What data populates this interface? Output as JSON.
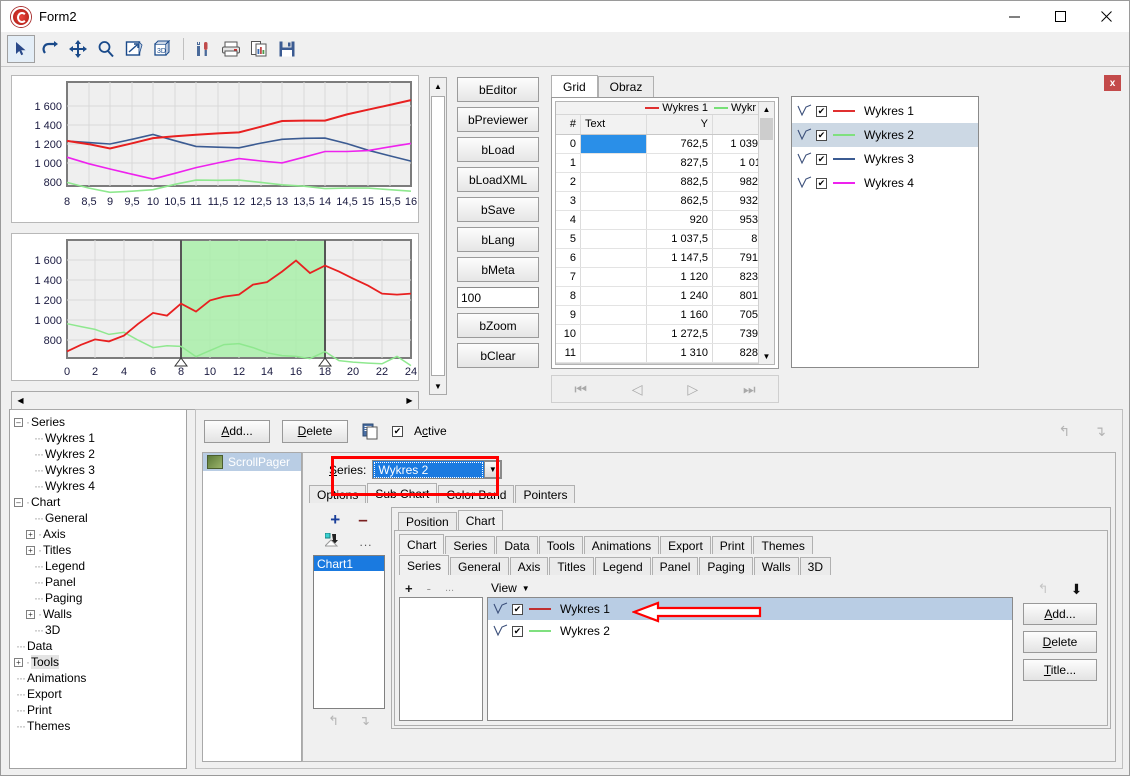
{
  "window": {
    "title": "Form2",
    "minimize": "–",
    "maximize": "□",
    "close": "✕"
  },
  "toolbar": {
    "items": [
      {
        "name": "pointer-icon",
        "label": "Pointer"
      },
      {
        "name": "undo-icon",
        "label": "Undo"
      },
      {
        "name": "move-icon",
        "label": "Move"
      },
      {
        "name": "zoom-icon",
        "label": "Zoom"
      },
      {
        "name": "export-chart-icon",
        "label": "Export"
      },
      {
        "name": "three-d-icon",
        "label": "3D"
      },
      {
        "name": "tools-icon",
        "label": "Tools"
      },
      {
        "name": "print-icon",
        "label": "Print"
      },
      {
        "name": "copy-chart-icon",
        "label": "Copy"
      },
      {
        "name": "save-icon",
        "label": "Save"
      }
    ]
  },
  "buttons_column": {
    "items": [
      "bEditor",
      "bPreviewer",
      "bLoad",
      "bLoadXML",
      "bSave",
      "bLang",
      "bMeta"
    ],
    "zoom_value": "100",
    "items_after": [
      "bZoom",
      "bClear"
    ]
  },
  "grid_tabs": {
    "tabs": [
      "Grid",
      "Obraz"
    ],
    "active": "Grid"
  },
  "grid": {
    "legend": [
      {
        "label": "Wykres 1",
        "color": "#e03030"
      },
      {
        "label": "Wykr",
        "color": "#77e077"
      }
    ],
    "headers": [
      "#",
      "Text",
      "Y",
      ""
    ],
    "rows": [
      {
        "n": "0",
        "text": "",
        "y": "762,5",
        "y2": "1 039,"
      },
      {
        "n": "1",
        "text": "",
        "y": "827,5",
        "y2": "1 01"
      },
      {
        "n": "2",
        "text": "",
        "y": "882,5",
        "y2": "982,"
      },
      {
        "n": "3",
        "text": "",
        "y": "862,5",
        "y2": "932,"
      },
      {
        "n": "4",
        "text": "",
        "y": "920",
        "y2": "953,"
      },
      {
        "n": "5",
        "text": "",
        "y": "1 037,5",
        "y2": "8͵"
      },
      {
        "n": "6",
        "text": "",
        "y": "1 147,5",
        "y2": "791,"
      },
      {
        "n": "7",
        "text": "",
        "y": "1 120",
        "y2": "823,"
      },
      {
        "n": "8",
        "text": "",
        "y": "1 240",
        "y2": "801,"
      },
      {
        "n": "9",
        "text": "",
        "y": "1 160",
        "y2": "705,"
      },
      {
        "n": "10",
        "text": "",
        "y": "1 272,5",
        "y2": "739,"
      },
      {
        "n": "11",
        "text": "",
        "y": "1 310",
        "y2": "828,"
      }
    ],
    "nav": [
      "⏮",
      "◁",
      "▷",
      "⏭"
    ],
    "nav2": [
      "⏮",
      "◁",
      "▷",
      "⏭"
    ]
  },
  "series_panel": {
    "close_label": "x",
    "items": [
      {
        "label": "Wykres 1",
        "color": "#e03030",
        "checked": true,
        "selected": false
      },
      {
        "label": "Wykres 2",
        "color": "#7fe07f",
        "checked": true,
        "selected": true
      },
      {
        "label": "Wykres 3",
        "color": "#3b5b92",
        "checked": true,
        "selected": false
      },
      {
        "label": "Wykres 4",
        "color": "#ee22ee",
        "checked": true,
        "selected": false
      }
    ]
  },
  "tree": {
    "nodes": [
      {
        "label": "Series",
        "depth": 0,
        "box": "-"
      },
      {
        "label": "Wykres 1",
        "depth": 1,
        "box": ""
      },
      {
        "label": "Wykres 2",
        "depth": 1,
        "box": ""
      },
      {
        "label": "Wykres 3",
        "depth": 1,
        "box": ""
      },
      {
        "label": "Wykres 4",
        "depth": 1,
        "box": ""
      },
      {
        "label": "Chart",
        "depth": 0,
        "box": "-"
      },
      {
        "label": "General",
        "depth": 1,
        "box": ""
      },
      {
        "label": "Axis",
        "depth": 1,
        "box": "+"
      },
      {
        "label": "Titles",
        "depth": 1,
        "box": "+"
      },
      {
        "label": "Legend",
        "depth": 1,
        "box": ""
      },
      {
        "label": "Panel",
        "depth": 1,
        "box": ""
      },
      {
        "label": "Paging",
        "depth": 1,
        "box": ""
      },
      {
        "label": "Walls",
        "depth": 1,
        "box": "+"
      },
      {
        "label": "3D",
        "depth": 1,
        "box": ""
      },
      {
        "label": "Data",
        "depth": 0,
        "box": ""
      },
      {
        "label": "Tools",
        "depth": 0,
        "box": "+",
        "highlight": true
      },
      {
        "label": "Animations",
        "depth": 0,
        "box": ""
      },
      {
        "label": "Export",
        "depth": 0,
        "box": ""
      },
      {
        "label": "Print",
        "depth": 0,
        "box": ""
      },
      {
        "label": "Themes",
        "depth": 0,
        "box": ""
      }
    ]
  },
  "editor": {
    "add_label": "Add...",
    "delete_label": "Delete",
    "active_label": "Active",
    "active_checked": "✔",
    "copy_icon": "copy-icon",
    "tool_list_item": "ScrollPager",
    "series_field_label": "Series:",
    "series_value": "Wykres 2",
    "tool_tabs": [
      "Options",
      "Sub Chart",
      "Color Band",
      "Pointers"
    ],
    "tool_tab_active": "Sub Chart",
    "sub_tabs_l1": [
      "Position",
      "Chart"
    ],
    "sub_tabs_l1_active": "Chart",
    "chart_list_item": "Chart1",
    "plus_icon": "plus-icon",
    "minus_icon": "minus-icon",
    "clone_icon": "clone-icon",
    "ellipsis_icon": "ellipsis-icon"
  },
  "chart_tabs": {
    "level1": [
      "Chart",
      "Series",
      "Data",
      "Tools",
      "Animations",
      "Export",
      "Print",
      "Themes"
    ],
    "level1_active": "Chart",
    "level2": [
      "Series",
      "General",
      "Axis",
      "Titles",
      "Legend",
      "Panel",
      "Paging",
      "Walls",
      "3D"
    ],
    "level2_active": "Series"
  },
  "series_editor": {
    "plus": "+",
    "minus": "-",
    "ellipsis": "...",
    "view_label": "View",
    "items": [
      {
        "label": "Wykres 1",
        "color": "#c03030",
        "checked": true,
        "selected": true
      },
      {
        "label": "Wykres 2",
        "color": "#7fe07f",
        "checked": true,
        "selected": false
      }
    ],
    "side_buttons": [
      "Add...",
      "Delete",
      "Title..."
    ],
    "up_icon": "up-arrow-icon",
    "down_icon": "down-arrow-icon"
  },
  "annotation": {
    "arrow_color": "#ff0000",
    "box_color": "#ff0000"
  },
  "chart_data": [
    {
      "type": "line",
      "title": "",
      "xlabel": "",
      "ylabel": "",
      "xlim": [
        8,
        16
      ],
      "ylim": [
        650,
        1700
      ],
      "yticks": [
        "800",
        "1 000",
        "1 200",
        "1 400",
        "1 600"
      ],
      "xticks": [
        "8",
        "8,5",
        "9",
        "9,5",
        "10",
        "10,5",
        "11",
        "11,5",
        "12",
        "12,5",
        "13",
        "13,5",
        "14",
        "14,5",
        "15",
        "15,5",
        "16"
      ],
      "grid": true,
      "x": [
        8,
        8.5,
        9,
        9.5,
        10,
        10.5,
        11,
        11.5,
        12,
        12.5,
        13,
        13.5,
        14,
        14.5,
        15,
        15.5,
        16
      ],
      "series": [
        {
          "name": "Wykres 1",
          "color": "#e82020",
          "values": [
            1240,
            1205,
            1160,
            1215,
            1270,
            1290,
            1305,
            1320,
            1330,
            1390,
            1450,
            1455,
            1455,
            1520,
            1570,
            1620,
            1670
          ]
        },
        {
          "name": "Wykres 3",
          "color": "#3b5b92",
          "values": [
            1240,
            1232,
            1225,
            1275,
            1325,
            1260,
            1200,
            1192,
            1185,
            1235,
            1275,
            1285,
            1288,
            1230,
            1160,
            1100,
            1045
          ]
        },
        {
          "name": "Wykres 4",
          "color": "#ee22ee",
          "values": [
            1070,
            1000,
            945,
            890,
            840,
            900,
            960,
            1010,
            1055,
            1030,
            1010,
            1070,
            1130,
            1130,
            1140,
            1180,
            1215
          ]
        },
        {
          "name": "Wykres 2",
          "color": "#8fe88f",
          "values": [
            805,
            745,
            700,
            712,
            728,
            785,
            830,
            828,
            830,
            805,
            780,
            765,
            740,
            745,
            745,
            728,
            712
          ]
        }
      ]
    },
    {
      "type": "line",
      "title": "",
      "xlabel": "",
      "ylabel": "",
      "xlim": [
        0,
        24
      ],
      "ylim": [
        620,
        1700
      ],
      "yticks": [
        "800",
        "1 000",
        "1 200",
        "1 400",
        "1 600"
      ],
      "xticks": [
        "0",
        "2",
        "4",
        "6",
        "8",
        "10",
        "12",
        "14",
        "16",
        "18",
        "20",
        "22",
        "24"
      ],
      "grid": true,
      "selection_band": {
        "from": 8,
        "to": 16,
        "color": "#a9eea9"
      },
      "x": [
        0,
        1,
        2,
        3,
        4,
        5,
        6,
        7,
        8,
        9,
        10,
        11,
        12,
        13,
        14,
        15,
        16,
        17,
        18,
        19,
        20,
        21,
        22,
        23,
        24
      ],
      "series": [
        {
          "name": "Wykres 1",
          "color": "#e82020",
          "values": [
            762,
            828,
            882,
            862,
            920,
            1037,
            1147,
            1120,
            1240,
            1160,
            1272,
            1310,
            1330,
            1430,
            1455,
            1560,
            1670,
            1545,
            1620,
            1560,
            1490,
            1420,
            1340,
            1330,
            1340
          ]
        },
        {
          "name": "Wykres 2",
          "color": "#8fe88f",
          "values": [
            1039,
            1010,
            982,
            932,
            953,
            875,
            800,
            818,
            812,
            710,
            770,
            830,
            840,
            800,
            748,
            720,
            712,
            690,
            760,
            670,
            655,
            645,
            638,
            712,
            620
          ]
        }
      ]
    }
  ]
}
